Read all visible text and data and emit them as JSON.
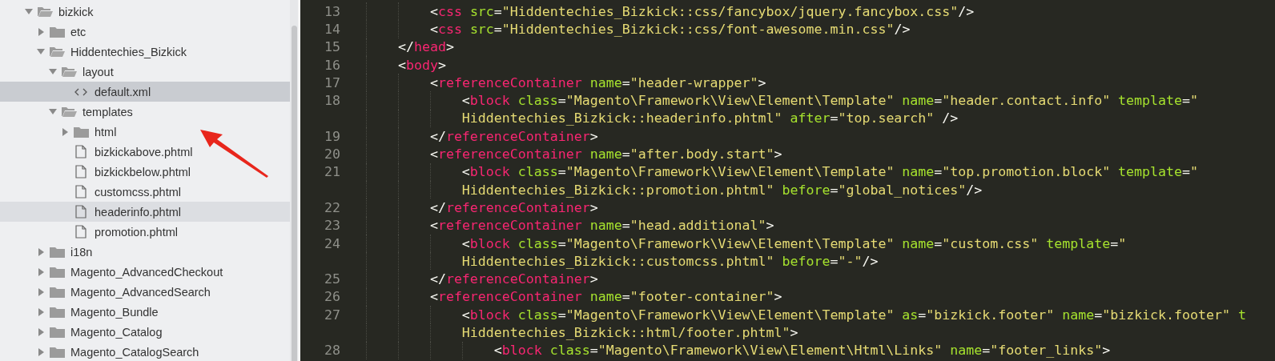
{
  "sidebar": {
    "tree": [
      {
        "label": "bizkick",
        "kind": "folder",
        "expanded": true,
        "selected": false,
        "children": [
          {
            "label": "etc",
            "kind": "folder",
            "expanded": false,
            "selected": false
          },
          {
            "label": "Hiddentechies_Bizkick",
            "kind": "folder",
            "expanded": true,
            "selected": false,
            "children": [
              {
                "label": "layout",
                "kind": "folder",
                "expanded": true,
                "selected": false,
                "children": [
                  {
                    "label": "default.xml",
                    "kind": "code",
                    "selected": true
                  }
                ]
              },
              {
                "label": "templates",
                "kind": "folder",
                "expanded": true,
                "selected": false,
                "children": [
                  {
                    "label": "html",
                    "kind": "folder",
                    "expanded": false,
                    "selected": false
                  },
                  {
                    "label": "bizkickabove.phtml",
                    "kind": "file",
                    "selected": false
                  },
                  {
                    "label": "bizkickbelow.phtml",
                    "kind": "file",
                    "selected": false
                  },
                  {
                    "label": "customcss.phtml",
                    "kind": "file",
                    "selected": false
                  },
                  {
                    "label": "headerinfo.phtml",
                    "kind": "file",
                    "selected": false,
                    "hovered": true
                  },
                  {
                    "label": "promotion.phtml",
                    "kind": "file",
                    "selected": false
                  }
                ]
              }
            ]
          },
          {
            "label": "i18n",
            "kind": "folder",
            "expanded": false,
            "selected": false
          },
          {
            "label": "Magento_AdvancedCheckout",
            "kind": "folder",
            "expanded": false,
            "selected": false
          },
          {
            "label": "Magento_AdvancedSearch",
            "kind": "folder",
            "expanded": false,
            "selected": false
          },
          {
            "label": "Magento_Bundle",
            "kind": "folder",
            "expanded": false,
            "selected": false
          },
          {
            "label": "Magento_Catalog",
            "kind": "folder",
            "expanded": false,
            "selected": false
          },
          {
            "label": "Magento_CatalogSearch",
            "kind": "folder",
            "expanded": false,
            "selected": false
          }
        ]
      }
    ]
  },
  "editor": {
    "lines": [
      {
        "children": [
          {
            "number": "13",
            "tokens": [
              {
                "kind": "punct",
                "text": "<"
              },
              {
                "kind": "tag",
                "text": "css"
              },
              {
                "kind": "attr",
                "text": " src"
              },
              {
                "kind": "punct",
                "text": "="
              },
              {
                "kind": "string",
                "text": "\"Hiddentechies_Bizkick::css/fancybox/jquery.fancybox.css\""
              },
              {
                "kind": "punct",
                "text": "/>"
              }
            ]
          },
          {
            "number": "14",
            "tokens": [
              {
                "kind": "punct",
                "text": "<"
              },
              {
                "kind": "tag",
                "text": "css"
              },
              {
                "kind": "attr",
                "text": " src"
              },
              {
                "kind": "punct",
                "text": "="
              },
              {
                "kind": "string",
                "text": "\"Hiddentechies_Bizkick::css/font-awesome.min.css\""
              },
              {
                "kind": "punct",
                "text": "/>"
              }
            ]
          }
        ]
      },
      {
        "number": "15",
        "tokens": [
          {
            "kind": "punct",
            "text": "</"
          },
          {
            "kind": "tag",
            "text": "head"
          },
          {
            "kind": "punct",
            "text": ">"
          }
        ]
      },
      {
        "number": "16",
        "tokens": [
          {
            "kind": "punct",
            "text": "<"
          },
          {
            "kind": "tag",
            "text": "body"
          },
          {
            "kind": "punct",
            "text": ">"
          }
        ],
        "children": [
          {
            "number": "17",
            "tokens": [
              {
                "kind": "punct",
                "text": "<"
              },
              {
                "kind": "tag",
                "text": "referenceContainer"
              },
              {
                "kind": "attr",
                "text": " name"
              },
              {
                "kind": "punct",
                "text": "="
              },
              {
                "kind": "string",
                "text": "\"header-wrapper\""
              },
              {
                "kind": "punct",
                "text": ">"
              }
            ],
            "children": [
              {
                "number": "18",
                "tokens": [
                  {
                    "kind": "punct",
                    "text": "<"
                  },
                  {
                    "kind": "tag",
                    "text": "block"
                  },
                  {
                    "kind": "attr",
                    "text": " class"
                  },
                  {
                    "kind": "punct",
                    "text": "="
                  },
                  {
                    "kind": "string",
                    "text": "\"Magento\\Framework\\View\\Element\\Template\""
                  },
                  {
                    "kind": "attr",
                    "text": " name"
                  },
                  {
                    "kind": "punct",
                    "text": "="
                  },
                  {
                    "kind": "string",
                    "text": "\"header.contact.info\""
                  },
                  {
                    "kind": "attr",
                    "text": " template"
                  },
                  {
                    "kind": "punct",
                    "text": "="
                  },
                  {
                    "kind": "string",
                    "text": "\""
                  }
                ],
                "continuation": [
                  {
                    "kind": "string",
                    "text": "Hiddentechies_Bizkick::headerinfo.phtml\""
                  },
                  {
                    "kind": "attr",
                    "text": " after"
                  },
                  {
                    "kind": "punct",
                    "text": "="
                  },
                  {
                    "kind": "string",
                    "text": "\"top.search\""
                  },
                  {
                    "kind": "punct",
                    "text": " />"
                  }
                ]
              }
            ]
          },
          {
            "number": "19",
            "tokens": [
              {
                "kind": "punct",
                "text": "</"
              },
              {
                "kind": "tag",
                "text": "referenceContainer"
              },
              {
                "kind": "punct",
                "text": ">"
              }
            ]
          },
          {
            "number": "20",
            "tokens": [
              {
                "kind": "punct",
                "text": "<"
              },
              {
                "kind": "tag",
                "text": "referenceContainer"
              },
              {
                "kind": "attr",
                "text": " name"
              },
              {
                "kind": "punct",
                "text": "="
              },
              {
                "kind": "string",
                "text": "\"after.body.start\""
              },
              {
                "kind": "punct",
                "text": ">"
              }
            ],
            "children": [
              {
                "number": "21",
                "tokens": [
                  {
                    "kind": "punct",
                    "text": "<"
                  },
                  {
                    "kind": "tag",
                    "text": "block"
                  },
                  {
                    "kind": "attr",
                    "text": " class"
                  },
                  {
                    "kind": "punct",
                    "text": "="
                  },
                  {
                    "kind": "string",
                    "text": "\"Magento\\Framework\\View\\Element\\Template\""
                  },
                  {
                    "kind": "attr",
                    "text": " name"
                  },
                  {
                    "kind": "punct",
                    "text": "="
                  },
                  {
                    "kind": "string",
                    "text": "\"top.promotion.block\""
                  },
                  {
                    "kind": "attr",
                    "text": " template"
                  },
                  {
                    "kind": "punct",
                    "text": "="
                  },
                  {
                    "kind": "string",
                    "text": "\""
                  }
                ],
                "continuation": [
                  {
                    "kind": "string",
                    "text": "Hiddentechies_Bizkick::promotion.phtml\""
                  },
                  {
                    "kind": "attr",
                    "text": " before"
                  },
                  {
                    "kind": "punct",
                    "text": "="
                  },
                  {
                    "kind": "string",
                    "text": "\"global_notices\""
                  },
                  {
                    "kind": "punct",
                    "text": "/>"
                  }
                ]
              }
            ]
          },
          {
            "number": "22",
            "tokens": [
              {
                "kind": "punct",
                "text": "</"
              },
              {
                "kind": "tag",
                "text": "referenceContainer"
              },
              {
                "kind": "punct",
                "text": ">"
              }
            ]
          },
          {
            "number": "23",
            "tokens": [
              {
                "kind": "punct",
                "text": "<"
              },
              {
                "kind": "tag",
                "text": "referenceContainer"
              },
              {
                "kind": "attr",
                "text": " name"
              },
              {
                "kind": "punct",
                "text": "="
              },
              {
                "kind": "string",
                "text": "\"head.additional\""
              },
              {
                "kind": "punct",
                "text": ">"
              }
            ],
            "children": [
              {
                "number": "24",
                "tokens": [
                  {
                    "kind": "punct",
                    "text": "<"
                  },
                  {
                    "kind": "tag",
                    "text": "block"
                  },
                  {
                    "kind": "attr",
                    "text": " class"
                  },
                  {
                    "kind": "punct",
                    "text": "="
                  },
                  {
                    "kind": "string",
                    "text": "\"Magento\\Framework\\View\\Element\\Template\""
                  },
                  {
                    "kind": "attr",
                    "text": " name"
                  },
                  {
                    "kind": "punct",
                    "text": "="
                  },
                  {
                    "kind": "string",
                    "text": "\"custom.css\""
                  },
                  {
                    "kind": "attr",
                    "text": " template"
                  },
                  {
                    "kind": "punct",
                    "text": "="
                  },
                  {
                    "kind": "string",
                    "text": "\""
                  }
                ],
                "continuation": [
                  {
                    "kind": "string",
                    "text": "Hiddentechies_Bizkick::customcss.phtml\""
                  },
                  {
                    "kind": "attr",
                    "text": " before"
                  },
                  {
                    "kind": "punct",
                    "text": "="
                  },
                  {
                    "kind": "string",
                    "text": "\"-\""
                  },
                  {
                    "kind": "punct",
                    "text": "/>"
                  }
                ]
              }
            ]
          },
          {
            "number": "25",
            "tokens": [
              {
                "kind": "punct",
                "text": "</"
              },
              {
                "kind": "tag",
                "text": "referenceContainer"
              },
              {
                "kind": "punct",
                "text": ">"
              }
            ]
          },
          {
            "number": "26",
            "tokens": [
              {
                "kind": "punct",
                "text": "<"
              },
              {
                "kind": "tag",
                "text": "referenceContainer"
              },
              {
                "kind": "attr",
                "text": " name"
              },
              {
                "kind": "punct",
                "text": "="
              },
              {
                "kind": "string",
                "text": "\"footer-container\""
              },
              {
                "kind": "punct",
                "text": ">"
              }
            ],
            "children": [
              {
                "number": "27",
                "tokens": [
                  {
                    "kind": "punct",
                    "text": "<"
                  },
                  {
                    "kind": "tag",
                    "text": "block"
                  },
                  {
                    "kind": "attr",
                    "text": " class"
                  },
                  {
                    "kind": "punct",
                    "text": "="
                  },
                  {
                    "kind": "string",
                    "text": "\"Magento\\Framework\\View\\Element\\Template\""
                  },
                  {
                    "kind": "attr",
                    "text": " as"
                  },
                  {
                    "kind": "punct",
                    "text": "="
                  },
                  {
                    "kind": "string",
                    "text": "\"bizkick.footer\""
                  },
                  {
                    "kind": "attr",
                    "text": " name"
                  },
                  {
                    "kind": "punct",
                    "text": "="
                  },
                  {
                    "kind": "string",
                    "text": "\"bizkick.footer\""
                  },
                  {
                    "kind": "attr",
                    "text": " t"
                  }
                ],
                "continuation": [
                  {
                    "kind": "string",
                    "text": "Hiddentechies_Bizkick::html/footer.phtml\""
                  },
                  {
                    "kind": "punct",
                    "text": ">"
                  }
                ],
                "children": [
                  {
                    "number": "28",
                    "tokens": [
                      {
                        "kind": "punct",
                        "text": "<"
                      },
                      {
                        "kind": "tag",
                        "text": "block"
                      },
                      {
                        "kind": "attr",
                        "text": " class"
                      },
                      {
                        "kind": "punct",
                        "text": "="
                      },
                      {
                        "kind": "string",
                        "text": "\"Magento\\Framework\\View\\Element\\Html\\Links\""
                      },
                      {
                        "kind": "attr",
                        "text": " name"
                      },
                      {
                        "kind": "punct",
                        "text": "="
                      },
                      {
                        "kind": "string",
                        "text": "\"footer_links\""
                      },
                      {
                        "kind": "punct",
                        "text": ">"
                      }
                    ]
                  }
                ]
              }
            ]
          }
        ]
      }
    ]
  }
}
